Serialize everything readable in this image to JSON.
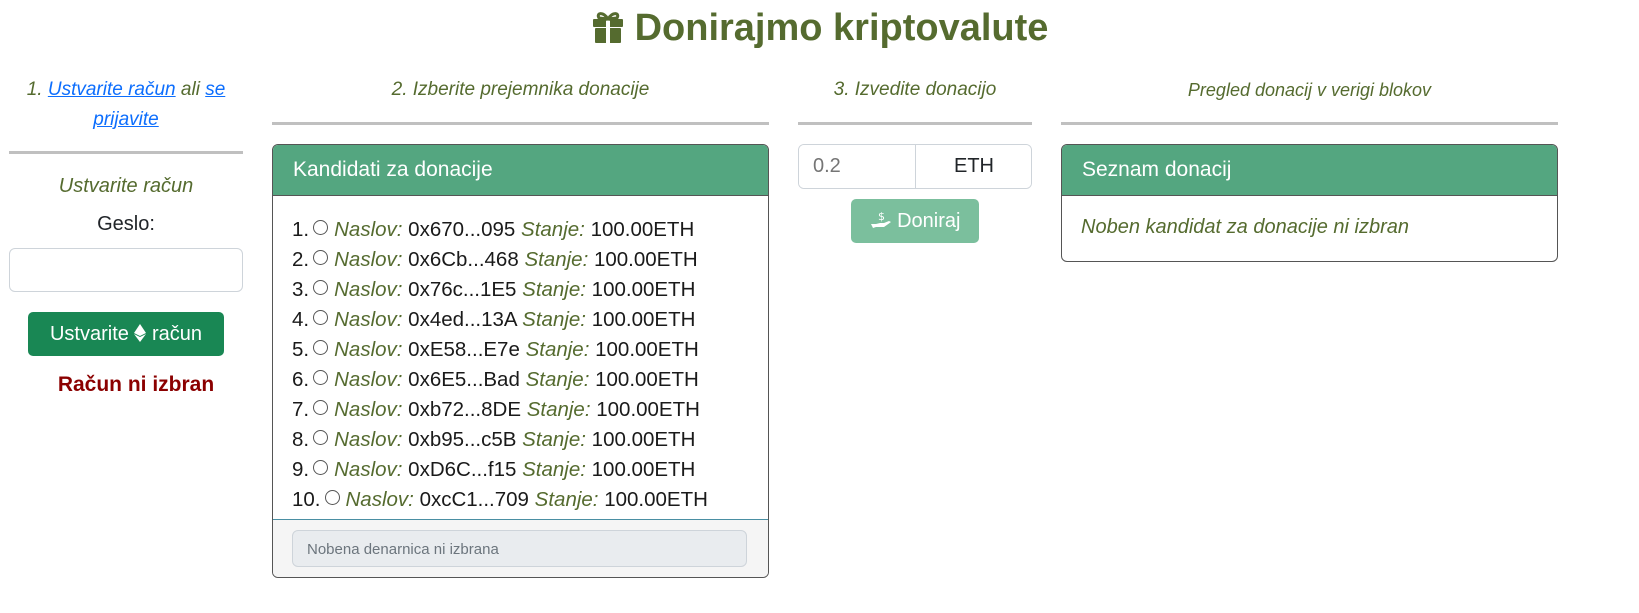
{
  "title": "Donirajmo kriptovalute",
  "step1": {
    "num": "1.",
    "link1": "Ustvarite račun",
    "or": "ali",
    "link2a": "se",
    "link2b": "prijavite",
    "subtitle": "Ustvarite račun",
    "password_label": "Geslo:",
    "password_value": "",
    "create_btn_pre": "Ustvarite",
    "create_btn_post": "račun",
    "status": "Račun ni izbran"
  },
  "step2": {
    "heading": "2. Izberite prejemnika donacije",
    "card_title": "Kandidati za donacije",
    "address_label": "Naslov:",
    "balance_label": "Stanje:",
    "candidates": [
      {
        "num": "1.",
        "addr": "0x670...095",
        "bal": "100.00ETH"
      },
      {
        "num": "2.",
        "addr": "0x6Cb...468",
        "bal": "100.00ETH"
      },
      {
        "num": "3.",
        "addr": "0x76c...1E5",
        "bal": "100.00ETH"
      },
      {
        "num": "4.",
        "addr": "0x4ed...13A",
        "bal": "100.00ETH"
      },
      {
        "num": "5.",
        "addr": "0xE58...E7e",
        "bal": "100.00ETH"
      },
      {
        "num": "6.",
        "addr": "0x6E5...Bad",
        "bal": "100.00ETH"
      },
      {
        "num": "7.",
        "addr": "0xb72...8DE",
        "bal": "100.00ETH"
      },
      {
        "num": "8.",
        "addr": "0xb95...c5B",
        "bal": "100.00ETH"
      },
      {
        "num": "9.",
        "addr": "0xD6C...f15",
        "bal": "100.00ETH"
      },
      {
        "num": "10.",
        "addr": "0xcC1...709",
        "bal": "100.00ETH"
      }
    ],
    "wallet_status": "Nobena denarnica ni izbrana"
  },
  "step3": {
    "heading": "3. Izvedite donacijo",
    "amount_placeholder": "0.2",
    "currency": "ETH",
    "donate_label": "Doniraj"
  },
  "overview": {
    "heading": "Pregled donacij v verigi blokov",
    "card_title": "Seznam donacij",
    "empty_text": "Noben kandidat za donacije ni izbran"
  },
  "colors": {
    "title": "#556b2f",
    "card_header": "#54a680",
    "create_button": "#198754",
    "donate_button": "#7bbf9d",
    "status_text": "#8b0000",
    "link": "#0d6efd"
  }
}
